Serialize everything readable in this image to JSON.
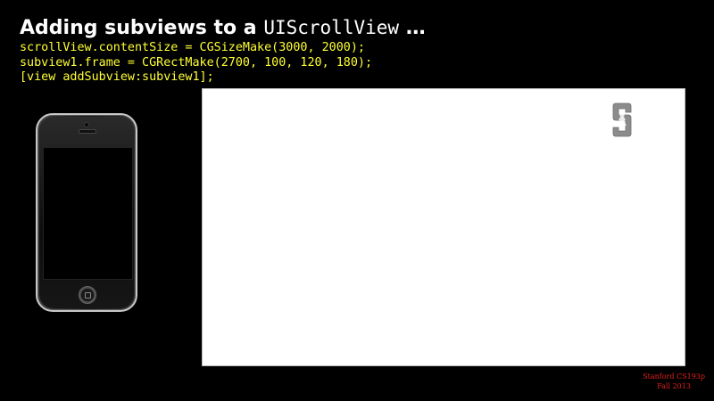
{
  "slide": {
    "title_text": "Adding subviews to a ",
    "title_code": "UIScrollView",
    "title_suffix": " …",
    "code_lines": [
      "scrollView.contentSize = CGSizeMake(3000, 2000);",
      "subview1.frame = CGRectMake(2700, 100, 120, 180);",
      "[view addSubview:subview1];"
    ]
  },
  "footer": {
    "course": "Stanford CS193p",
    "term": "Fall 2013"
  },
  "colors": {
    "background": "#000000",
    "title": "#ffffff",
    "code": "#ffff33",
    "footer": "#e0211b",
    "content_area": "#ffffff",
    "logo_gray": "#8c8c8c"
  },
  "icons": {
    "device": "iphone-icon",
    "subview": "stanford-logo-icon"
  }
}
